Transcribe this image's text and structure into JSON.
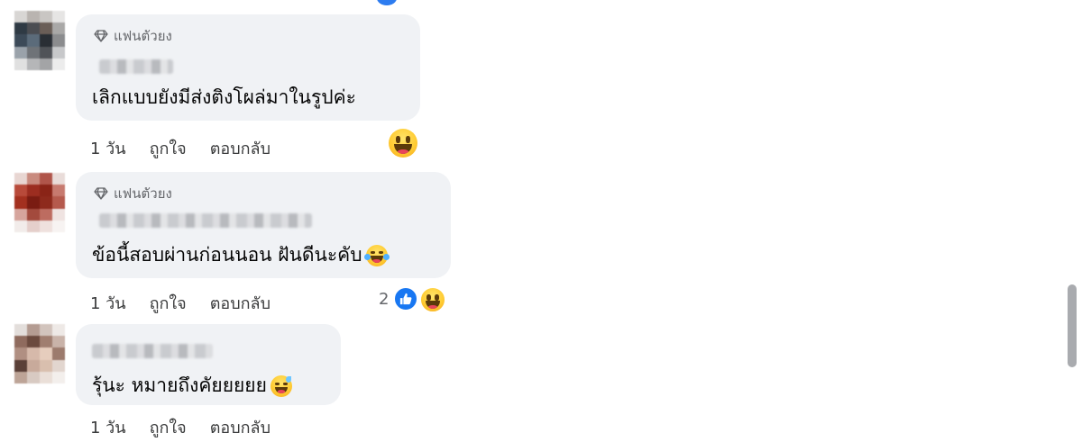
{
  "comments": [
    {
      "badge": "แฟนตัวยง",
      "text": "เลิกแบบยังมีส่งติงโผล่มาในรูปค่ะ",
      "time": "1 วัน",
      "like_label": "ถูกใจ",
      "reply_label": "ตอบกลับ"
    },
    {
      "badge": "แฟนตัวยง",
      "text": "ข้อนี้สอบผ่านก่อนนอน ฝันดีนะคับ",
      "time": "1 วัน",
      "like_label": "ถูกใจ",
      "reply_label": "ตอบกลับ",
      "reaction_count": "2"
    },
    {
      "text": "รุ้นะ หมายถึงคัยยยยย",
      "time": "1 วัน",
      "like_label": "ถูกใจ",
      "reply_label": "ตอบกลับ"
    }
  ],
  "icons": {
    "badge": "diamond-icon",
    "reaction_laugh": "laughing-emoji-icon",
    "reaction_like": "thumbs-up-icon",
    "inline_emoji_1": "tears-of-joy-emoji-icon",
    "inline_emoji_2": "grinning-sweat-emoji-icon"
  },
  "colors": {
    "bubble_bg": "#f0f2f5",
    "like_blue": "#1877f2",
    "meta_text": "#65676b"
  }
}
